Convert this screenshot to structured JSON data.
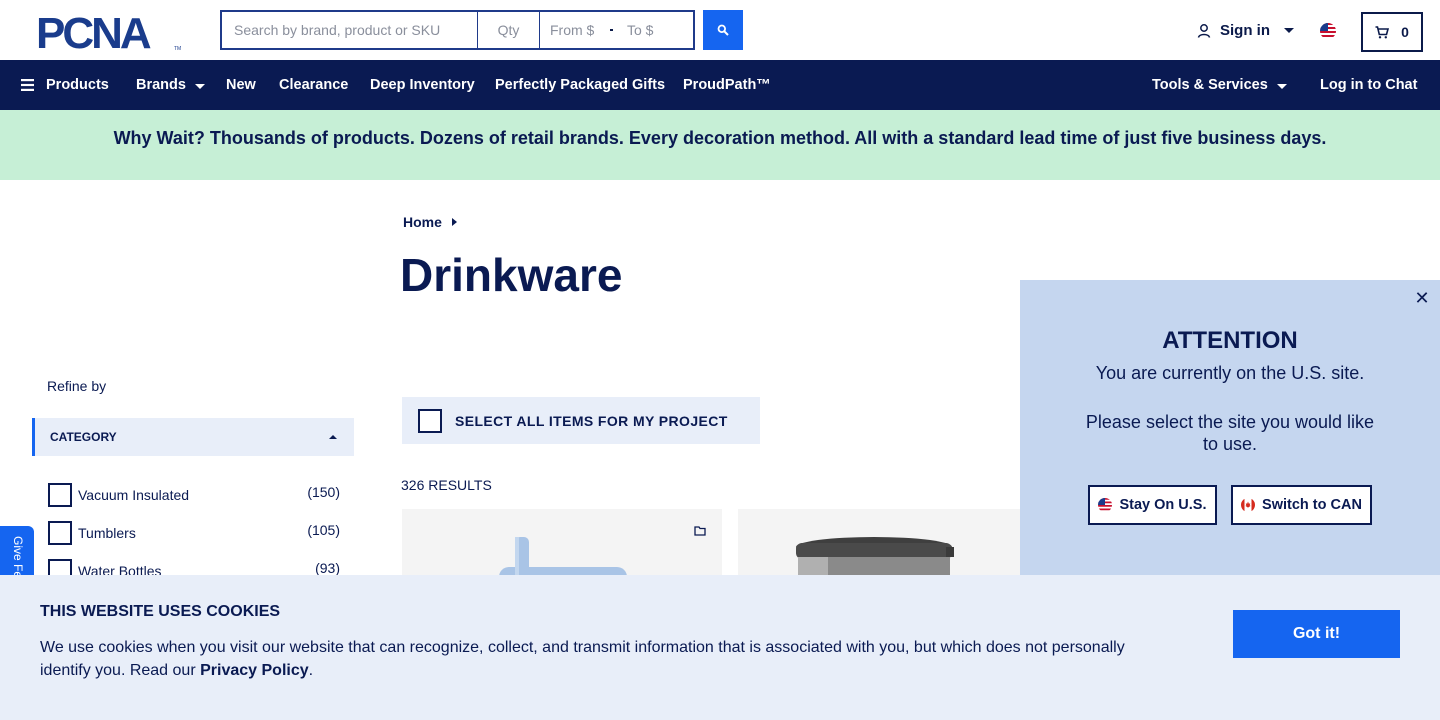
{
  "header": {
    "logo_text": "PCNA",
    "search": {
      "placeholder": "Search by brand, product or SKU",
      "value": ""
    },
    "qty": {
      "placeholder": "Qty"
    },
    "price_from": {
      "placeholder": "From $"
    },
    "price_to": {
      "placeholder": "To $"
    },
    "signin_label": "Sign in",
    "cart_count": "0"
  },
  "nav": {
    "products": "Products",
    "brands": "Brands",
    "new": "New",
    "clearance": "Clearance",
    "deep_inventory": "Deep Inventory",
    "gifts": "Perfectly Packaged Gifts",
    "proudpath": "ProudPath™",
    "tools": "Tools & Services",
    "chat": "Log in to Chat"
  },
  "promo": "Why Wait? Thousands of products. Dozens of retail brands. Every decoration method. All with a standard lead time of just five business days.",
  "breadcrumb": {
    "home": "Home"
  },
  "page_title": "Drinkware",
  "sidebar": {
    "refine_label": "Refine by",
    "category_label": "CATEGORY",
    "facets": [
      {
        "label": "Vacuum Insulated",
        "count": "(150)"
      },
      {
        "label": "Tumblers",
        "count": "(105)"
      },
      {
        "label": "Water Bottles",
        "count": "(93)"
      }
    ],
    "feedback_label": "Give Feedback"
  },
  "select_all_label": "SELECT ALL ITEMS FOR MY PROJECT",
  "results_label": "326 RESULTS",
  "site_modal": {
    "title": "ATTENTION",
    "line1": "You are currently on the U.S. site.",
    "line2": "Please select the site you would like to use.",
    "stay_label": "Stay On U.S.",
    "switch_label": "Switch to CAN"
  },
  "cookie": {
    "title": "THIS WEBSITE USES COOKIES",
    "text": "We use cookies when you visit our website that can recognize, collect, and transmit information that is associated with you, but which does not personally identify you. Read our",
    "link": "Privacy Policy",
    "period": ".",
    "button": "Got it!"
  },
  "colors": {
    "navy": "#0a1a52",
    "accent_blue": "#1565f0",
    "promo_green": "#c6efd6",
    "panel_blue": "#c5d6ef",
    "light_blue": "#e8eef9"
  }
}
